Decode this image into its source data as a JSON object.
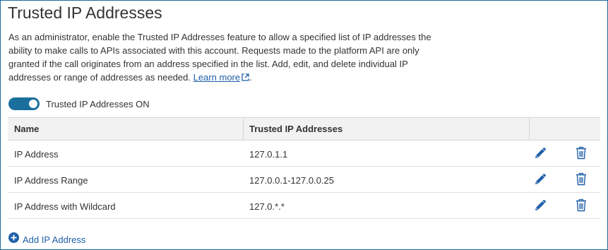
{
  "page": {
    "title": "Trusted IP Addresses",
    "description": "As an administrator, enable the Trusted IP Addresses feature to allow a specified list of IP addresses the ability to make calls to APIs associated with this account. Requests made to the platform API are only granted if the call originates from an address specified in the list. Add, edit, and delete individual IP addresses or range of addresses as needed.",
    "learn_more": "Learn more",
    "trailing_period": "."
  },
  "toggle": {
    "label": "Trusted IP Addresses ON",
    "state": "on"
  },
  "table": {
    "headers": {
      "name": "Name",
      "ip": "Trusted IP Addresses"
    },
    "rows": [
      {
        "name": "IP Address",
        "ip": "127.0.1.1"
      },
      {
        "name": "IP Address Range",
        "ip": "127.0.0.1-127.0.0.25"
      },
      {
        "name": "IP Address with Wildcard",
        "ip": "127.0.*.*"
      }
    ]
  },
  "add_button": {
    "label": "Add IP Address"
  },
  "colors": {
    "accent": "#1a6f9c",
    "link": "#1f5fa8",
    "icon": "#1f5fa8",
    "header_bg": "#f2f2f2"
  },
  "icons": {
    "edit": "pencil-icon",
    "delete": "trash-icon",
    "add": "plus-circle-icon",
    "external": "external-link-icon"
  }
}
